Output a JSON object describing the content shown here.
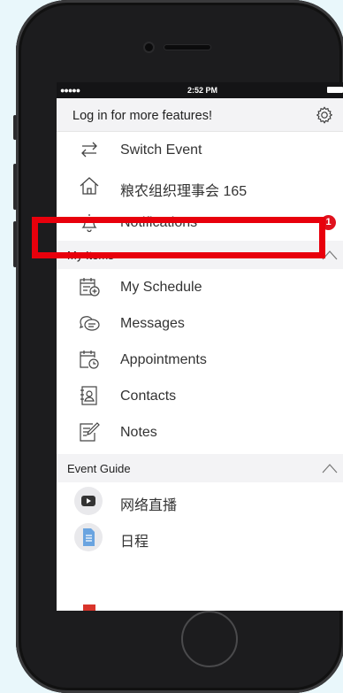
{
  "status_bar": {
    "time": "2:52 PM",
    "signal": "●●●●●"
  },
  "header": {
    "login_text": "Log in for more features!",
    "settings_icon": "gear-icon"
  },
  "menu": [
    {
      "label": "Switch Event",
      "icon": "switch-arrows-icon"
    },
    {
      "label": "粮农组织理事会 165",
      "icon": "home-icon"
    },
    {
      "label": "Notifications",
      "icon": "bell-icon",
      "badge": "1"
    }
  ],
  "my_items": {
    "title": "My Items",
    "items": [
      {
        "label": "My Schedule",
        "icon": "calendar-add-icon"
      },
      {
        "label": "Messages",
        "icon": "chat-bubbles-icon"
      },
      {
        "label": "Appointments",
        "icon": "calendar-clock-icon"
      },
      {
        "label": "Contacts",
        "icon": "address-book-icon"
      },
      {
        "label": "Notes",
        "icon": "note-pencil-icon"
      }
    ]
  },
  "event_guide": {
    "title": "Event Guide",
    "items": [
      {
        "label": "网络直播",
        "icon": "play-video-icon"
      },
      {
        "label": "日程",
        "icon": "document-icon"
      }
    ]
  },
  "colors": {
    "highlight": "#e8000c",
    "badge": "#e0121e"
  }
}
